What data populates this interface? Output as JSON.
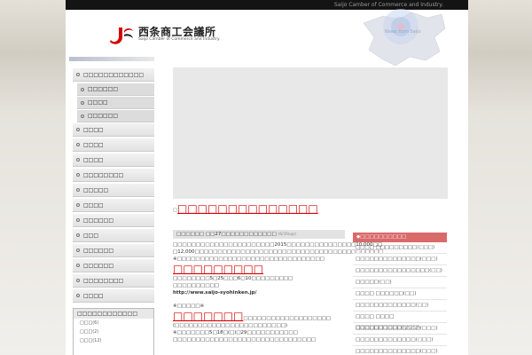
{
  "header": {
    "tagline": "Saijo Camber of Commerce and Industry.",
    "logo_title": "西条商工会議所",
    "logo_subtitle": "Saijo Camber of Commerce and Industry.",
    "news_from": "News from Saijo"
  },
  "sidebar": {
    "menu": [
      {
        "label": "□□□□□□□□□□□□"
      },
      {
        "label": "□□□□□□"
      },
      {
        "label": "□□□□"
      },
      {
        "label": "□□□□□□"
      },
      {
        "label": "□□□□"
      },
      {
        "label": "□□□□"
      },
      {
        "label": "□□□□"
      },
      {
        "label": "□□□□□□□□"
      },
      {
        "label": "□□□□□"
      },
      {
        "label": "□□□□"
      },
      {
        "label": "□□□□□□"
      },
      {
        "label": "□□□"
      },
      {
        "label": "□□□□□□"
      },
      {
        "label": "□□□□□□"
      },
      {
        "label": "□□□□□□□□"
      },
      {
        "label": "□□□□"
      }
    ],
    "box_title": "□□□□□□□□□□□□",
    "box_rows": [
      {
        "label": "□□□",
        "count": "(6)"
      },
      {
        "label": "□□□",
        "count": "(2)"
      },
      {
        "label": "□□□",
        "count": "(12)"
      }
    ]
  },
  "main": {
    "headline_mark": "□",
    "headline": "□□□□□□□□□□□□□□",
    "post_title": "□□□□□□ □□27□□□□□□□□□□□□",
    "post_date": "(6/1fsup)",
    "p1": "□□□□□□□□□□□□□□□□□□□□□□2015□□□□□□□□□□□□□□□10,000□□",
    "p2": "□12,000□□□□□□□□□□□□□□□□□□□□□□□□□□□□□□□□□□□□□□□□□",
    "p3": "※□□□□□□□□□□□□□□□□□□□□□□□□□□□□□□□□",
    "red1": "□□□□□□□□□",
    "p4": "□□□□□□□□5□25□□□6□10□□□□□□□□□",
    "p5": "□□□□□□□□□□",
    "url": "http://www.saijo-syohinken.jp/",
    "p6": "※□□□□□※",
    "red2": "□□□□□□□",
    "red2_tail": "□□□□□□□□□□□□□□□□□□□",
    "p7": "(□□□□□□□□□□□□□□□□□□□□□□□□)",
    "p8": "※□□□□□□□5□18□(□)□29□□□□□□□□□□□",
    "p9": "□□□□□□□□□□□□□□□□□□□□□□□□□□□□□□□"
  },
  "categories": {
    "title": "◆□□□□□□□□□□",
    "items": [
      {
        "label": "□□□□ □□□□□□□□□",
        "count": "(□□□)"
      },
      {
        "label": "□□□□□□□□□□□□□□",
        "count": "(□□□)"
      },
      {
        "label": "□□□□□□□□□□□□□□□□",
        "count": "(□□)"
      },
      {
        "label": "□□□□□",
        "count": "(□□)"
      },
      {
        "label": "□□□□ □□□□□□",
        "count": "(□□)"
      },
      {
        "label": "□□□□□□□□□□□□□",
        "count": "(□□)"
      },
      {
        "label": "□□□□ □□□□ □□□□□□□□□□",
        "count": "(□□□)"
      },
      {
        "label": "□□□□□□□□□□□□□□",
        "count": "(□□□)"
      },
      {
        "label": "□□□□□□□□□□□□□",
        "count": "(□□□)"
      },
      {
        "label": "□□□□□□□□□□□□□□",
        "count": "(□□□)"
      },
      {
        "label": "□□□□□□",
        "count": "(□□)"
      }
    ]
  },
  "colors": {
    "accent_red": "#d40000",
    "category_header": "#d96a6a",
    "topbar": "#141414"
  },
  "icons": {
    "logo": "saijo-logo-icon",
    "map": "ehime-map-icon"
  }
}
